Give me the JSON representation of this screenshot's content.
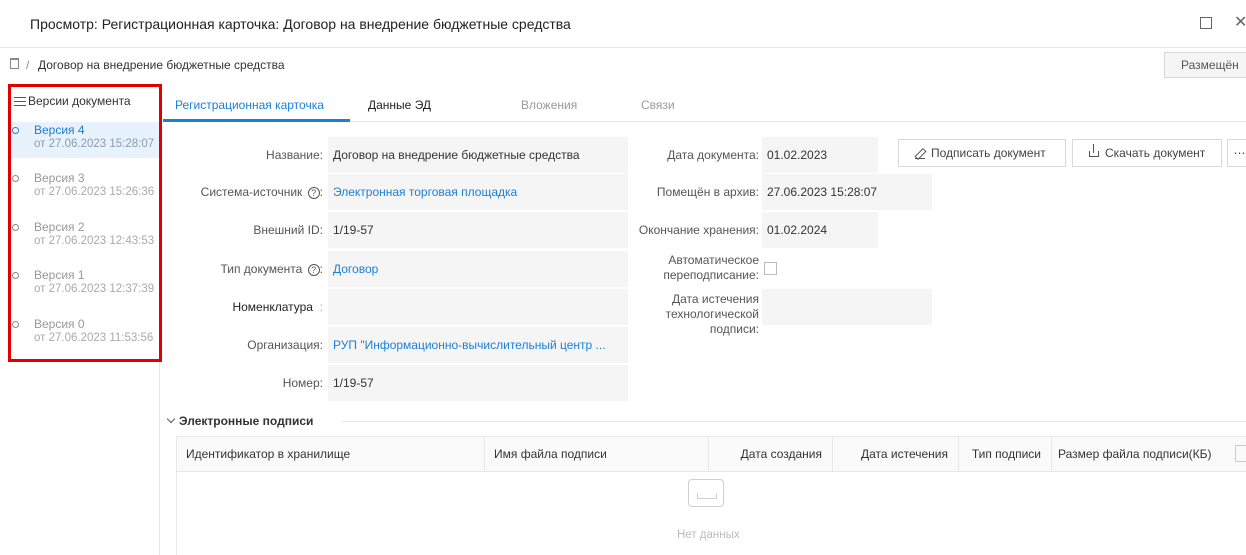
{
  "window": {
    "title": "Просмотр: Регистрационная карточка: Договор на внедрение бюджетные средства"
  },
  "breadcrumb": {
    "separator": "/",
    "current": "Договор на внедрение бюджетные средства"
  },
  "status_button": "Размещён",
  "sidebar": {
    "header": "Версии документа",
    "versions": [
      {
        "name": "Версия 4",
        "date": "от 27.06.2023 15:28:07",
        "active": true
      },
      {
        "name": "Версия 3",
        "date": "от 27.06.2023 15:26:36",
        "active": false
      },
      {
        "name": "Версия 2",
        "date": "от 27.06.2023 12:43:53",
        "active": false
      },
      {
        "name": "Версия 1",
        "date": "от 27.06.2023 12:37:39",
        "active": false
      },
      {
        "name": "Версия 0",
        "date": "от 27.06.2023 11:53:56",
        "active": false
      }
    ]
  },
  "tabs": [
    {
      "label": "Регистрационная карточка",
      "active": true
    },
    {
      "label": "Данные ЭД",
      "active": false
    },
    {
      "label": "Вложения",
      "active": false
    },
    {
      "label": "Связи",
      "active": false
    }
  ],
  "left_fields": {
    "name_label": "Название:",
    "name_value": "Договор на внедрение  бюджетные средства",
    "source_label": "Система-источник",
    "source_colon": ":",
    "source_value": "Электронная торговая площадка",
    "external_id_label": "Внешний ID:",
    "external_id_value": "1/19-57",
    "doc_type_label": "Тип документа",
    "doc_type_colon": ":",
    "doc_type_value": "Договор",
    "nomenclature_label": "Номенклатура",
    "nomenclature_colon": ":",
    "nomenclature_value": "",
    "organization_label": "Организация:",
    "organization_value": "РУП \"Информационно-вычислительный центр ...",
    "number_label": "Номер:",
    "number_value": "1/19-57"
  },
  "right_fields": {
    "doc_date_label": "Дата документа:",
    "doc_date_value": "01.02.2023",
    "archived_label": "Помещён в архив:",
    "archived_value": "27.06.2023 15:28:07",
    "storage_end_label": "Окончание хранения:",
    "storage_end_value": "01.02.2024",
    "auto_resign_line1": "Автоматическое",
    "auto_resign_line2": "переподписание:",
    "auto_resign_checked": false,
    "tech_sign_line1": "Дата истечения",
    "tech_sign_line2": "технологической",
    "tech_sign_line3": "подписи:",
    "tech_sign_value": ""
  },
  "actions": {
    "sign": "Подписать документ",
    "download": "Скачать документ",
    "more": "⋯"
  },
  "signatures": {
    "title": "Электронные подписи",
    "columns": [
      "Идентификатор в хранилище",
      "Имя файла подписи",
      "Дата создания",
      "Дата истечения",
      "Тип подписи",
      "Размер файла подписи(КБ)"
    ],
    "empty_text": "Нет данных"
  },
  "colors": {
    "accent": "#1a7fd6",
    "highlight": "#e00000"
  }
}
